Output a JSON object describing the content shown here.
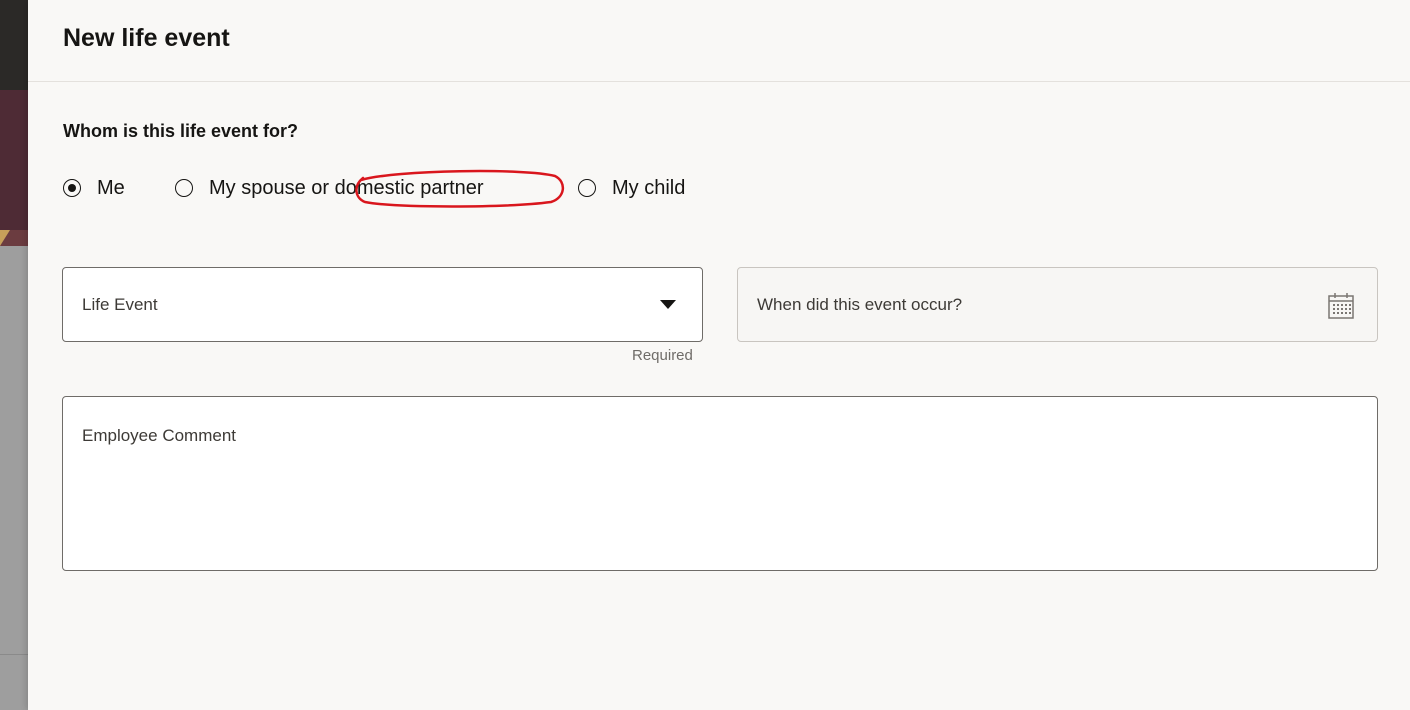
{
  "drawer": {
    "title": "New life event",
    "question": "Whom is this life event for?",
    "radio_options": [
      {
        "label": "Me",
        "checked": true
      },
      {
        "label": "My spouse or domestic partner",
        "checked": false
      },
      {
        "label": "My child",
        "checked": false
      }
    ],
    "life_event_field": {
      "label": "Life Event",
      "helper": "Required"
    },
    "date_field": {
      "label": "When did this event occur?",
      "icon": "calendar-icon"
    },
    "comment_field": {
      "label": "Employee Comment"
    }
  },
  "colors": {
    "annotation": "#d9161d",
    "text": "#161513",
    "border": "#6f6c68"
  }
}
